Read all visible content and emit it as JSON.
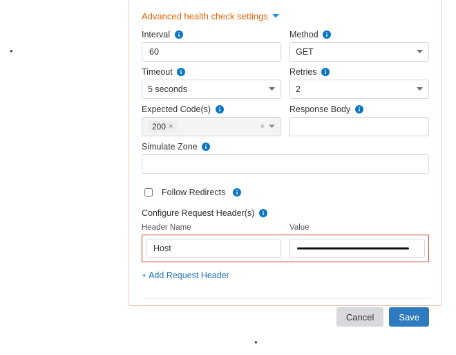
{
  "section_title": "Advanced health check settings",
  "fields": {
    "interval": {
      "label": "Interval",
      "value": "60"
    },
    "method": {
      "label": "Method",
      "value": "GET"
    },
    "timeout": {
      "label": "Timeout",
      "value": "5 seconds"
    },
    "retries": {
      "label": "Retries",
      "value": "2"
    },
    "expected_code": {
      "label": "Expected Code(s)",
      "tag": "200"
    },
    "response_body": {
      "label": "Response Body",
      "value": ""
    },
    "simulate_zone": {
      "label": "Simulate Zone",
      "value": ""
    }
  },
  "follow_redirects": {
    "label": "Follow Redirects",
    "checked": false
  },
  "configure_headers_label": "Configure Request Header(s)",
  "header_table": {
    "col_name": "Header Name",
    "col_value": "Value",
    "row": {
      "name": "Host",
      "value": ""
    }
  },
  "add_header_link": "+ Add Request Header",
  "buttons": {
    "cancel": "Cancel",
    "save": "Save"
  },
  "icons": {
    "info": "info-icon",
    "caret_down": "caret-down-icon",
    "chevron_down": "chevron-down-icon",
    "clear_x": "clear-x-icon"
  }
}
